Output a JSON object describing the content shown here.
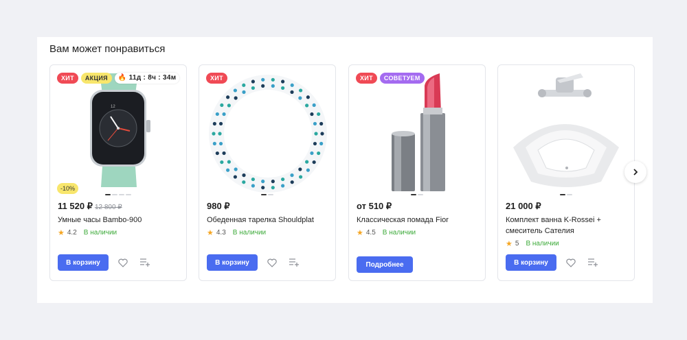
{
  "section": {
    "title": "Вам может понравиться"
  },
  "products": [
    {
      "badges": [
        {
          "text": "ХИТ",
          "kind": "red"
        },
        {
          "text": "АКЦИЯ",
          "kind": "yellow"
        }
      ],
      "timer": "11д : 8ч : 34м",
      "discount": "-10%",
      "price": "11 520 ₽",
      "old_price": "12 800 ₽",
      "name": "Умные часы Bambo-900",
      "rating": "4.2",
      "stock": "В наличии",
      "button": "В корзину",
      "image": "smartwatch-image"
    },
    {
      "badges": [
        {
          "text": "ХИТ",
          "kind": "red"
        }
      ],
      "price": "980 ₽",
      "name": "Обеденная тарелка Shouldplat",
      "rating": "4.3",
      "stock": "В наличии",
      "button": "В корзину",
      "image": "plate-image"
    },
    {
      "badges": [
        {
          "text": "ХИТ",
          "kind": "red"
        },
        {
          "text": "СОВЕТУЕМ",
          "kind": "purple"
        }
      ],
      "price": "от 510 ₽",
      "name": "Классическая помада Fior",
      "rating": "4.5",
      "stock": "В наличии",
      "button": "Подробнее",
      "image": "lipstick-image"
    },
    {
      "badges": [],
      "price": "21 000 ₽",
      "name": "Комплект ванна K-Rossei + смеситель Сателия",
      "rating": "5",
      "stock": "В наличии",
      "button": "В корзину",
      "image": "bathtub-image"
    }
  ],
  "colors": {
    "accent": "#4a6cf0",
    "hit": "#f04a55",
    "promo": "#f8e66c",
    "recommend": "#a46bf0",
    "in_stock": "#3daa3a",
    "star": "#f5a623"
  },
  "icons": [
    "favorite-heart-icon",
    "compare-list-icon",
    "chevron-right-icon",
    "star-icon",
    "fire-icon"
  ]
}
